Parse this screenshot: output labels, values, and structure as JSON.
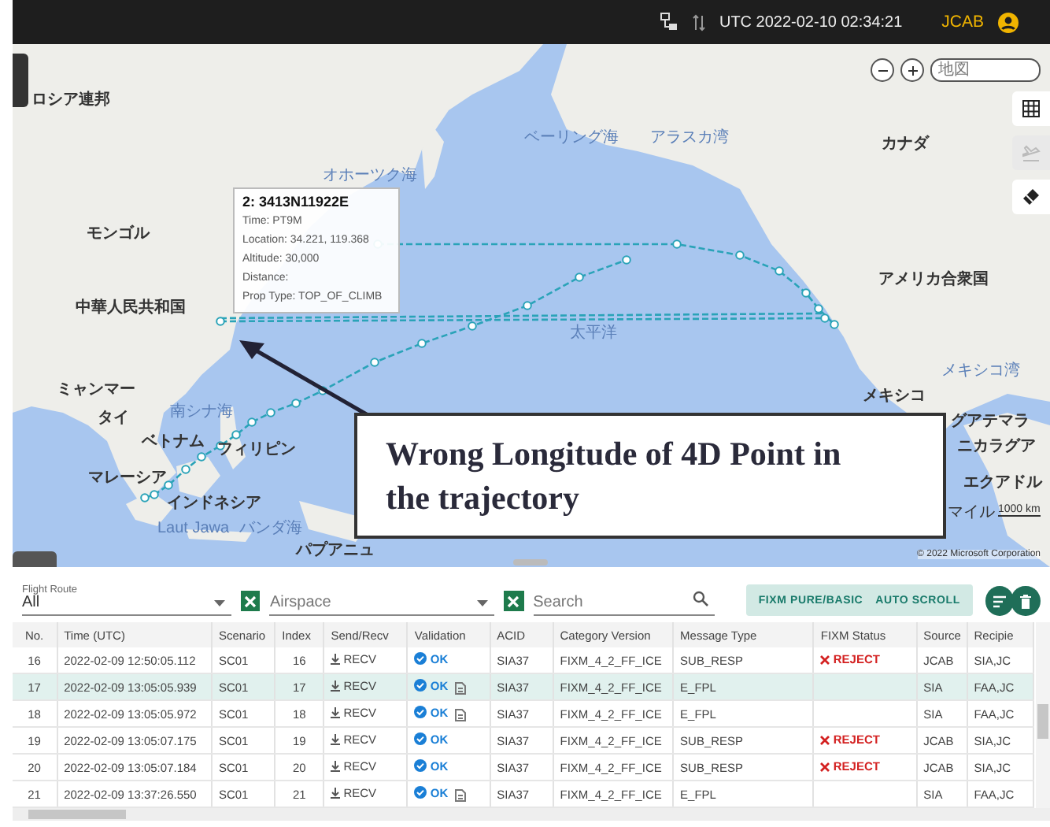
{
  "top_bar": {
    "clock": "UTC 2022-02-10 02:34:21",
    "user": "JCAB"
  },
  "map": {
    "search": {
      "placeholder": "地図"
    },
    "tools": [
      {
        "kind": "grid",
        "disabled": false
      },
      {
        "kind": "plane",
        "disabled": true
      },
      {
        "kind": "eraser",
        "disabled": false
      }
    ],
    "labels": [
      {
        "text": "ロシア連邦",
        "kind": "country"
      },
      {
        "text": "オホーツク海",
        "kind": "sea"
      },
      {
        "text": "ベーリング海",
        "kind": "sea"
      },
      {
        "text": "アラスカ湾",
        "kind": "sea"
      },
      {
        "text": "カナダ",
        "kind": "country"
      },
      {
        "text": "モンゴル",
        "kind": "country"
      },
      {
        "text": "中華人民共和国",
        "kind": "country"
      },
      {
        "text": "アメリカ合衆国",
        "kind": "country"
      },
      {
        "text": "太平洋",
        "kind": "sea"
      },
      {
        "text": "ミャンマー",
        "kind": "country"
      },
      {
        "text": "タイ",
        "kind": "country"
      },
      {
        "text": "南シナ海",
        "kind": "sea"
      },
      {
        "text": "ベトナム",
        "kind": "country"
      },
      {
        "text": "フィリピン",
        "kind": "country"
      },
      {
        "text": "マレーシア",
        "kind": "country"
      },
      {
        "text": "インドネシア",
        "kind": "country"
      },
      {
        "text": "Laut Jawa",
        "kind": "sea"
      },
      {
        "text": "バンダ海",
        "kind": "sea"
      },
      {
        "text": "パプアニュ",
        "kind": "country"
      },
      {
        "text": "メキシコ湾",
        "kind": "sea"
      },
      {
        "text": "メキシコ",
        "kind": "country"
      },
      {
        "text": "グアテマラ",
        "kind": "country"
      },
      {
        "text": "ニカラグア",
        "kind": "country"
      },
      {
        "text": "エクアドル",
        "kind": "country"
      }
    ],
    "tooltip": {
      "title": "2: 3413N11922E",
      "lines": [
        "Time: PT9M",
        "Location: 34.221, 119.368",
        "Altitude: 30,000",
        "Distance:",
        "Prop Type: TOP_OF_CLIMB"
      ]
    },
    "scale": {
      "unit": "マイル",
      "distance": "1000 km"
    },
    "copyright": "© 2022 Microsoft Corporation"
  },
  "annotation": {
    "text": "Wrong Longitude of 4D Point in the trajectory"
  },
  "filters": {
    "flight_route": {
      "label": "Flight Route",
      "value": "All"
    },
    "airspace": {
      "placeholder": "Airspace"
    },
    "search": {
      "placeholder": "Search"
    },
    "toggles": [
      "FIXM PURE/BASIC",
      "AUTO SCROLL"
    ]
  },
  "table": {
    "columns": [
      "No.",
      "Time (UTC)",
      "Scenario",
      "Index",
      "Send/Recv",
      "Validation",
      "ACID",
      "Category Version",
      "Message Type",
      "FIXM Status",
      "Source",
      "Recipie"
    ],
    "rows": [
      {
        "no": "16",
        "time": "2022-02-09 12:50:05.112",
        "scenario": "SC01",
        "index": "16",
        "send_recv": "RECV",
        "validation": "OK",
        "attachment": false,
        "acid": "SIA37",
        "category": "FIXM_4_2_FF_ICE",
        "message_type": "SUB_RESP",
        "fixm_status": "REJECT",
        "source": "JCAB",
        "recipient": "SIA,JC",
        "selected": false
      },
      {
        "no": "17",
        "time": "2022-02-09 13:05:05.939",
        "scenario": "SC01",
        "index": "17",
        "send_recv": "RECV",
        "validation": "OK",
        "attachment": true,
        "acid": "SIA37",
        "category": "FIXM_4_2_FF_ICE",
        "message_type": "E_FPL",
        "source": "SIA",
        "recipient": "FAA,JC",
        "selected": true
      },
      {
        "no": "18",
        "time": "2022-02-09 13:05:05.972",
        "scenario": "SC01",
        "index": "18",
        "send_recv": "RECV",
        "validation": "OK",
        "attachment": true,
        "acid": "SIA37",
        "category": "FIXM_4_2_FF_ICE",
        "message_type": "E_FPL",
        "source": "SIA",
        "recipient": "FAA,JC",
        "selected": false
      },
      {
        "no": "19",
        "time": "2022-02-09 13:05:07.175",
        "scenario": "SC01",
        "index": "19",
        "send_recv": "RECV",
        "validation": "OK",
        "attachment": false,
        "acid": "SIA37",
        "category": "FIXM_4_2_FF_ICE",
        "message_type": "SUB_RESP",
        "fixm_status": "REJECT",
        "source": "JCAB",
        "recipient": "SIA,JC",
        "selected": false
      },
      {
        "no": "20",
        "time": "2022-02-09 13:05:07.184",
        "scenario": "SC01",
        "index": "20",
        "send_recv": "RECV",
        "validation": "OK",
        "attachment": false,
        "acid": "SIA37",
        "category": "FIXM_4_2_FF_ICE",
        "message_type": "SUB_RESP",
        "fixm_status": "REJECT",
        "source": "JCAB",
        "recipient": "SIA,JC",
        "selected": false
      },
      {
        "no": "21",
        "time": "2022-02-09 13:37:26.550",
        "scenario": "SC01",
        "index": "21",
        "send_recv": "RECV",
        "validation": "OK",
        "attachment": true,
        "acid": "SIA37",
        "category": "FIXM_4_2_FF_ICE",
        "message_type": "E_FPL",
        "source": "SIA",
        "recipient": "FAA,JC",
        "selected": false
      }
    ]
  }
}
